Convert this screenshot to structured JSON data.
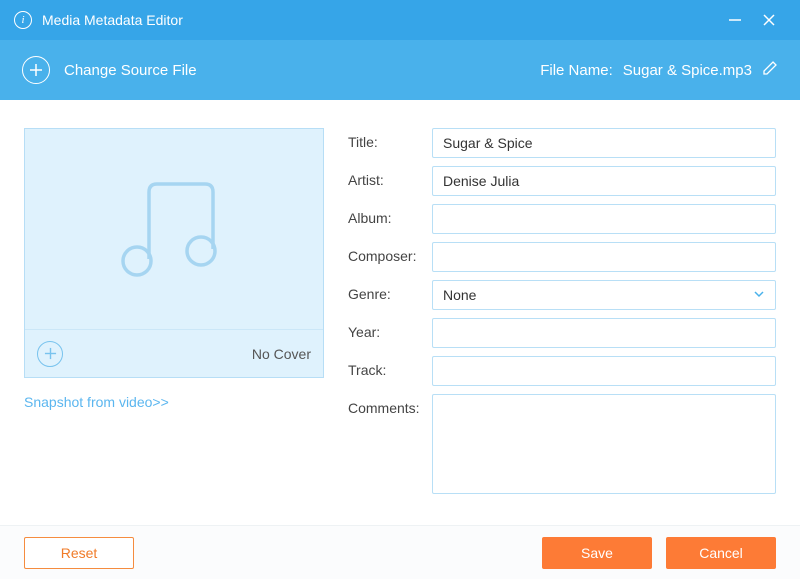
{
  "window": {
    "title": "Media Metadata Editor"
  },
  "toolbar": {
    "change_source_label": "Change Source File",
    "file_name_label": "File Name:",
    "file_name_value": "Sugar & Spice.mp3"
  },
  "cover": {
    "no_cover_label": "No Cover",
    "snapshot_link": "Snapshot from video>>"
  },
  "form": {
    "title": {
      "label": "Title:",
      "value": "Sugar & Spice"
    },
    "artist": {
      "label": "Artist:",
      "value": "Denise Julia"
    },
    "album": {
      "label": "Album:",
      "value": ""
    },
    "composer": {
      "label": "Composer:",
      "value": ""
    },
    "genre": {
      "label": "Genre:",
      "value": "None"
    },
    "year": {
      "label": "Year:",
      "value": ""
    },
    "track": {
      "label": "Track:",
      "value": ""
    },
    "comments": {
      "label": "Comments:",
      "value": ""
    }
  },
  "footer": {
    "reset": "Reset",
    "save": "Save",
    "cancel": "Cancel"
  }
}
